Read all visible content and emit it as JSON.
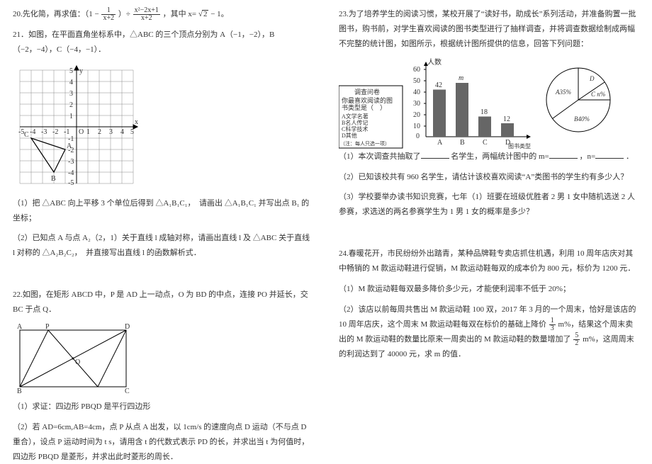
{
  "left": {
    "q20": "20.先化简，再求值：（1 −",
    "q20_frac1_num": "1",
    "q20_frac1_den": "x+2",
    "q20_mid": "）÷",
    "q20_frac2_num": "x²−2x+1",
    "q20_frac2_den": "x+2",
    "q20_tail1": "，其中 x=",
    "q20_sqrt": "2",
    "q20_tail2": " − 1。",
    "q21": "21．如图，在平面直角坐标系中，△ABC 的三个顶点分别为 A（−1，−2），B（−2，−4），C（−4，−1）．",
    "q21_1": "（1）把 △ABC 向上平移 3 个单位后得到 △A₁B₁C₁，　请画出 △A₁B₁C₁ 并写出点 B₁ 的坐标；",
    "q21_2": "（2）已知点 A 与点 A₂（2，1）关于直线 l 成轴对称，请画出直线 l 及 △ABC 关于直线 l 对称的 △A₂B₂C₂，　并直接写出直线 l 的函数解析式．",
    "q22": "22.如图，在矩形 ABCD 中，P 是 AD 上一动点，O 为 BD 的中点，连接 PO 并延长，交 BC 于点 Q．",
    "q22_1": "（1）求证：四边形 PBQD 是平行四边形",
    "q22_2": "（2）若 AD=6cm,AB=4cm，点 P 从点 A 出发，以 1cm/s 的速度向点 D 运动（不与点 D 重合），设点 P 运动时间为 t s，请用含 t 的代数式表示 PD 的长，并求出当 t 为何值时，四边形 PBQD 是菱形，并求出此时菱形的周长．",
    "rect": {
      "A": "A",
      "P": "P",
      "D": "D",
      "B": "B",
      "C": "C",
      "O": "O"
    },
    "grid_y": [
      "5",
      "4",
      "3",
      "2",
      "1",
      "-1",
      "-2",
      "-3",
      "-4",
      "-5"
    ],
    "grid_x": [
      "-5",
      "-4",
      "-3",
      "-2",
      "-1",
      "1",
      "2",
      "3",
      "4",
      "5"
    ],
    "grid_O": "O",
    "grid_ylab": "y",
    "grid_xlab": "x",
    "grid_A": "A",
    "grid_B": "B",
    "grid_C": "C"
  },
  "right": {
    "q23": "23.为了培养学生的阅读习惯，某校开展了“读好书，助成长”系列活动，并准备购置一批图书，购书前，对学生喜欢阅读的图书类型进行了抽样调查，并将调查数据绘制成两幅不完整的统计图，如图所示，根据统计图所提供的信息，回答下列问题：",
    "survey_title": "调查问卷",
    "survey_line1": "你最喜欢阅读的图",
    "survey_line2": "书类型是（　）",
    "survey_a": "A文学名著",
    "survey_b": "B名人传记",
    "survey_c": "C科学技术",
    "survey_d": "D其他",
    "survey_note": "（注：每人只选一项）",
    "bar_ylab": "人数",
    "bar_xlab": "图书类型",
    "bar_ticks": [
      "60",
      "50",
      "40",
      "30",
      "20",
      "10",
      "0"
    ],
    "bar_cats": [
      "A",
      "B",
      "C",
      "D"
    ],
    "bar_vals": [
      "42",
      "m",
      "18",
      "12"
    ],
    "pie_A": "A35%",
    "pie_B": "B40%",
    "pie_C": "C n%",
    "pie_D": "D",
    "q23_1a": "（1）本次调查共抽取了",
    "q23_1b": "名学生，两幅统计图中的 m=",
    "q23_1c": "，n=",
    "q23_1d": "．",
    "q23_2": "（2）已知该校共有 960 名学生，请估计该校喜欢阅读“A”类图书的学生约有多少人？",
    "q23_3": "（3）学校要举办读书知识竞赛，七年（1）班要在班级优胜者 2 男 1 女中随机选送 2 人参赛，求选送的两名参赛学生为 1 男 1 女的概率是多少？",
    "q24": "24.春暖花开，市民纷纷外出踏青，某种品牌鞋专卖店抓住机遇，利用 10 周年店庆对其中畅销的 M 款运动鞋进行促销，M 款运动鞋每双的成本价为 800 元，标价为 1200 元．",
    "q24_1": "（1）M 款运动鞋每双最多降价多少元，才能使利润率不低于 20%；",
    "q24_2a": "（2）该店以前每周共售出 M 款运动鞋 100 双，2017 年 3 月的一个周末，恰好是该店的 10 周年店庆，这个周末 M 款运动鞋每双在标价的基础上降价",
    "q24_f1n": "1",
    "q24_f1d": "3",
    "q24_2b": " m%，结果这个周末卖出的 M 款运动鞋的数量比原来一周卖出的 M 款运动鞋的数量增加了",
    "q24_f2n": "5",
    "q24_f2d": "2",
    "q24_2c": " m%，这周周末的利润达到了 40000 元，求 m 的值．"
  },
  "chart_data": {
    "type": "bar",
    "categories": [
      "A",
      "B",
      "C",
      "D"
    ],
    "values": [
      42,
      null,
      18,
      12
    ],
    "value_labels": [
      "42",
      "m",
      "18",
      "12"
    ],
    "title": "",
    "xlabel": "图书类型",
    "ylabel": "人数",
    "ylim": [
      0,
      60
    ],
    "pie": {
      "A": 35,
      "B": 40,
      "C": null,
      "D": null
    }
  }
}
